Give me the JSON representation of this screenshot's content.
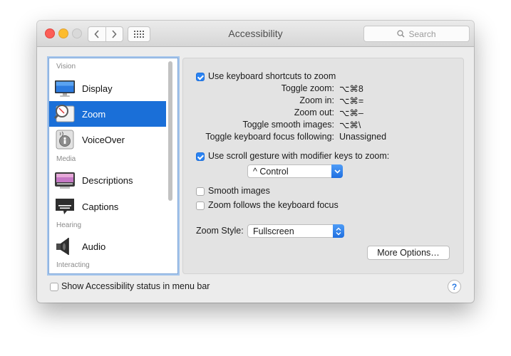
{
  "window": {
    "title": "Accessibility",
    "search_placeholder": "Search"
  },
  "sidebar": {
    "categories": {
      "vision": "Vision",
      "media": "Media",
      "hearing": "Hearing",
      "interacting": "Interacting"
    },
    "items": [
      {
        "label": "Display",
        "icon": "display-icon"
      },
      {
        "label": "Zoom",
        "icon": "zoom-icon",
        "selected": true
      },
      {
        "label": "VoiceOver",
        "icon": "voiceover-icon"
      },
      {
        "label": "Descriptions",
        "icon": "descriptions-icon"
      },
      {
        "label": "Captions",
        "icon": "captions-icon"
      },
      {
        "label": "Audio",
        "icon": "speaker-icon"
      }
    ]
  },
  "zoom": {
    "keyboard_shortcuts": {
      "label": "Use keyboard shortcuts to zoom",
      "checked": true
    },
    "shortcuts": [
      {
        "label": "Toggle zoom:",
        "value": "⌥⌘8"
      },
      {
        "label": "Zoom in:",
        "value": "⌥⌘="
      },
      {
        "label": "Zoom out:",
        "value": "⌥⌘–"
      },
      {
        "label": "Toggle smooth images:",
        "value": "⌥⌘\\"
      },
      {
        "label": "Toggle keyboard focus following:",
        "value": "Unassigned"
      }
    ],
    "scroll_gesture": {
      "label": "Use scroll gesture with modifier keys to zoom:",
      "checked": true
    },
    "modifier_key": {
      "value": "^ Control"
    },
    "smooth_images": {
      "label": "Smooth images",
      "checked": false
    },
    "follow_focus": {
      "label": "Zoom follows the keyboard focus",
      "checked": false
    },
    "zoom_style": {
      "label": "Zoom Style:",
      "value": "Fullscreen"
    },
    "more_options_label": "More Options…"
  },
  "footer": {
    "status_menu": {
      "label": "Show Accessibility status in menu bar",
      "checked": false
    },
    "help_label": "?"
  },
  "colors": {
    "selection": "#1a6fd8",
    "checkbox_on": "#2a83f3",
    "close": "#fc5e57",
    "minimize": "#fdbc2e"
  }
}
